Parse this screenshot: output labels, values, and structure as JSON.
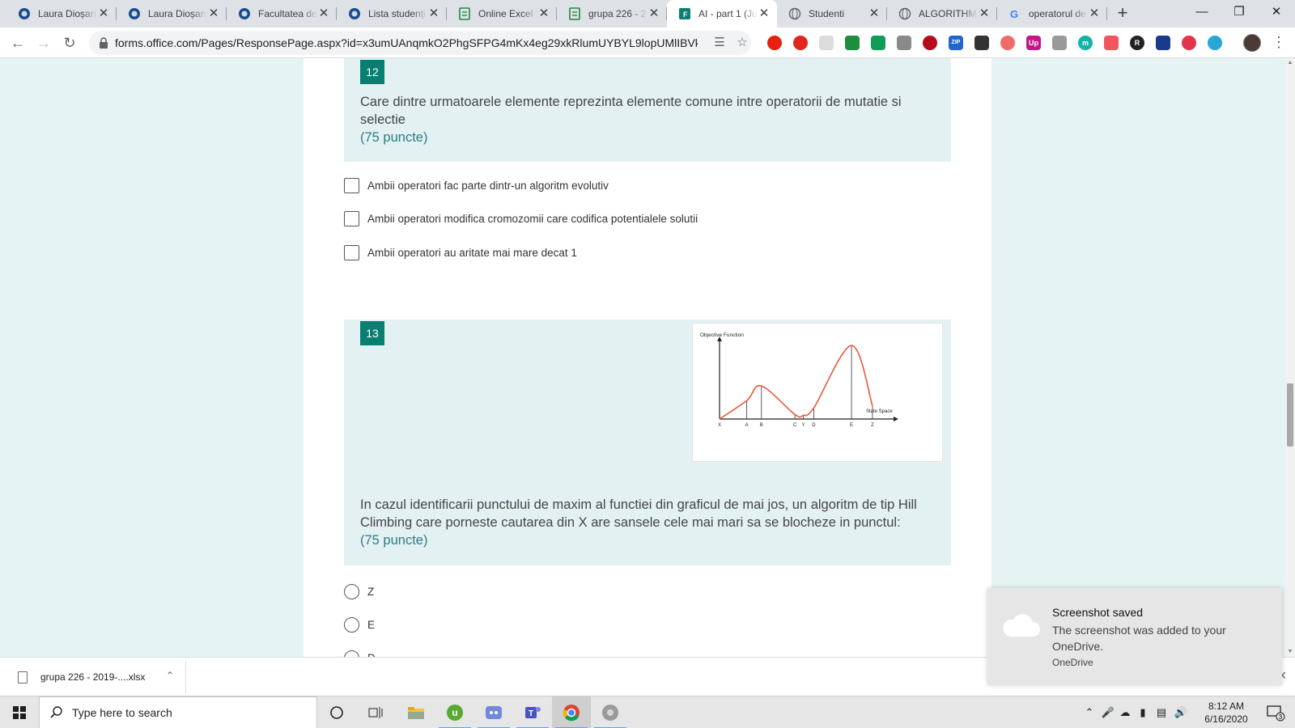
{
  "browser": {
    "tabs": [
      {
        "title": "Laura Dioșan",
        "icon": "circle-globe-icon",
        "color": "#1a4c8a"
      },
      {
        "title": "Laura Dioșan",
        "icon": "circle-globe-icon",
        "color": "#1a4c8a"
      },
      {
        "title": "Facultatea de",
        "icon": "circle-globe-icon",
        "color": "#1a4c8a"
      },
      {
        "title": "Lista studenți",
        "icon": "circle-globe-icon",
        "color": "#1a4c8a"
      },
      {
        "title": "Online Excel V",
        "icon": "spreadsheet-icon",
        "color": "#1e8e3e"
      },
      {
        "title": "grupa 226 - 2",
        "icon": "spreadsheet-icon",
        "color": "#1e8e3e"
      },
      {
        "title": "AI - part 1 (Ju",
        "icon": "forms-icon",
        "color": "#0b7e72",
        "active": true
      },
      {
        "title": "Studenti",
        "icon": "globe-icon",
        "color": "#5f6368"
      },
      {
        "title": "ALGORITHMI",
        "icon": "globe-icon",
        "color": "#5f6368"
      },
      {
        "title": "operatorul de",
        "icon": "google-icon",
        "color": "#4285f4"
      }
    ],
    "new_tab": "+",
    "url": "forms.office.com/Pages/ResponsePage.aspx?id=x3umUAnqmkO2PhgSFPG4mKx4eg29xkRlumUYBYL9lopUMlIBVk5..."
  },
  "form": {
    "questions": [
      {
        "number": "12",
        "text": "Care dintre urmatoarele elemente reprezinta elemente comune intre operatorii de mutatie si selectie",
        "points": "(75 puncte)",
        "options": [
          "Ambii operatori fac parte dintr-un algoritm evolutiv",
          "Ambii operatori modifica cromozomii care codifica potentialele solutii",
          "Ambii operatori au aritate mai mare decat 1"
        ]
      },
      {
        "number": "13",
        "text": "In cazul identificarii punctului de maxim al functiei din graficul de mai jos, un algoritm de tip Hill Climbing care porneste cautarea din X are sansele cele mai mari sa se blocheze in punctul:",
        "points": "(75 puncte)",
        "options": [
          "Z",
          "E",
          "D"
        ]
      }
    ]
  },
  "chart_data": {
    "type": "line",
    "title": "Objective Function",
    "xlabel": "State Space",
    "ylabel": "",
    "categories": [
      "X",
      "A",
      "B",
      "C",
      "Y",
      "D",
      "E",
      "Z"
    ],
    "x": [
      0.0,
      0.13,
      0.2,
      0.36,
      0.4,
      0.45,
      0.63,
      0.73
    ],
    "values": [
      0.0,
      0.25,
      0.45,
      0.06,
      0.05,
      0.15,
      1.0,
      0.18
    ],
    "xlim": [
      0,
      0.85
    ],
    "ylim": [
      0,
      1.1
    ],
    "line_color": "#e9563a"
  },
  "downloads": {
    "file_name": "grupa 226 - 2019-....xlsx"
  },
  "notification": {
    "title": "Screenshot saved",
    "body": "The screenshot was added to your OneDrive.",
    "app": "OneDrive"
  },
  "taskbar": {
    "search_placeholder": "Type here to search",
    "time": "8:12 AM",
    "date": "6/16/2020",
    "notification_count": "3"
  }
}
